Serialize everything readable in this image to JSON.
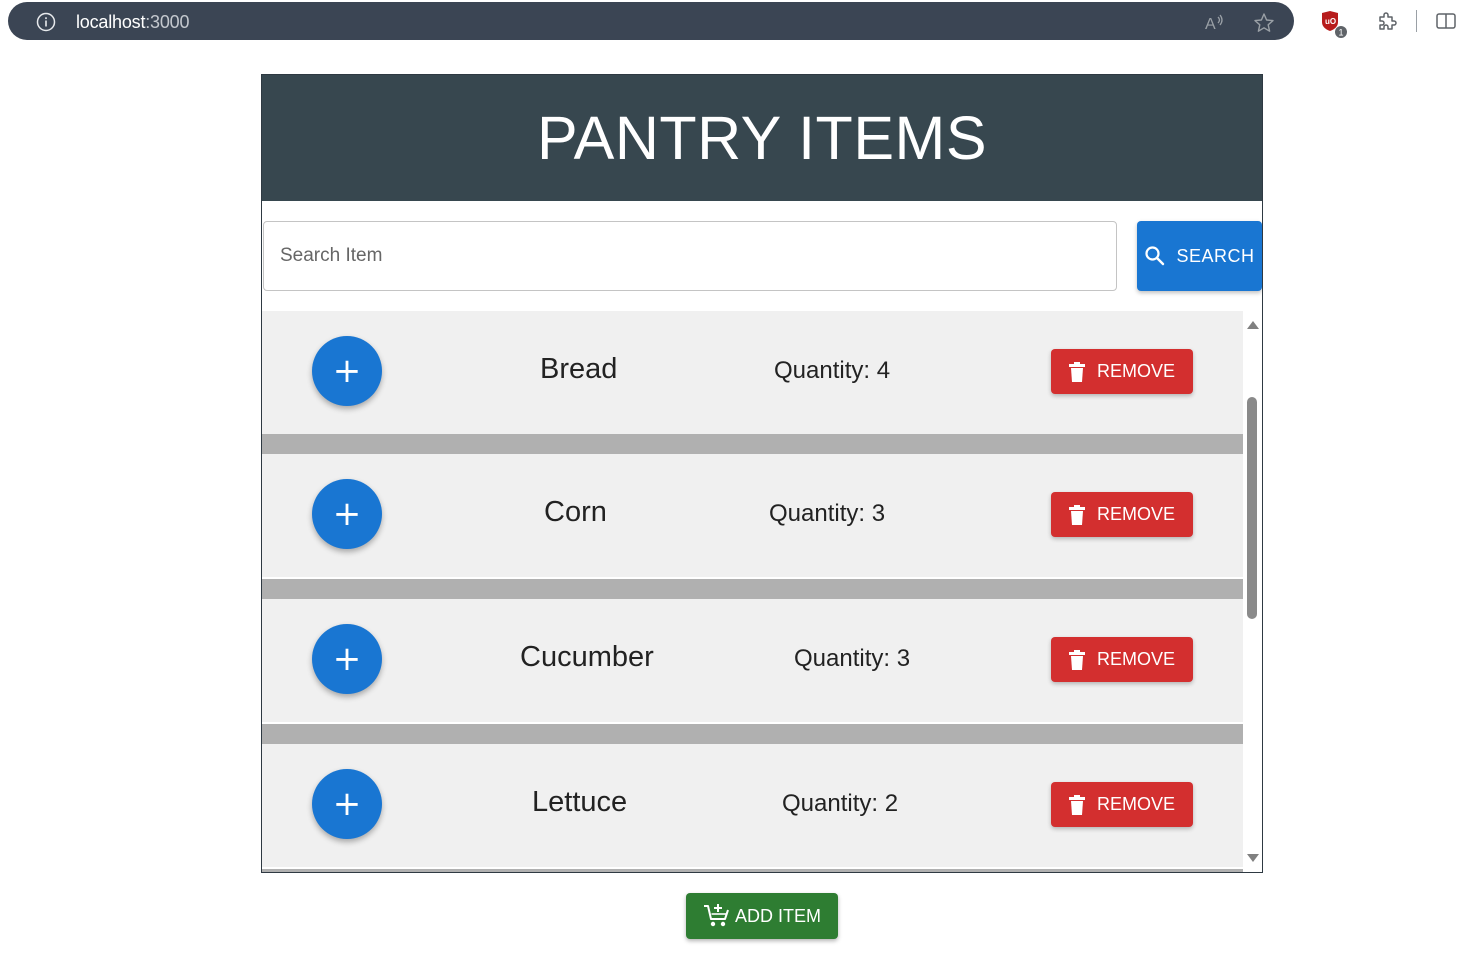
{
  "browser": {
    "url_host": "localhost",
    "url_port": ":3000",
    "ublock_badge": "1"
  },
  "header": {
    "title": "PANTRY ITEMS"
  },
  "search": {
    "placeholder": "Search Item",
    "value": "",
    "button_label": "SEARCH"
  },
  "items": [
    {
      "name": "Bread",
      "quantity": "Quantity: 4",
      "remove_label": "REMOVE",
      "add_label": "+"
    },
    {
      "name": "Corn",
      "quantity": "Quantity: 3",
      "remove_label": "REMOVE",
      "add_label": "+"
    },
    {
      "name": "Cucumber",
      "quantity": "Quantity: 3",
      "remove_label": "REMOVE",
      "add_label": "+"
    },
    {
      "name": "Lettuce",
      "quantity": "Quantity: 2",
      "remove_label": "REMOVE",
      "add_label": "+"
    }
  ],
  "footer": {
    "add_item_label": "ADD ITEM"
  },
  "icons": {
    "info": "info-icon",
    "read_aloud": "read-aloud-icon",
    "favorite": "star-icon",
    "ublock": "ublock-icon",
    "extensions": "puzzle-icon",
    "split_screen": "split-screen-icon",
    "search": "search-icon",
    "trash": "trash-icon",
    "add_cart": "add-shopping-cart-icon"
  },
  "colors": {
    "header_bg": "#37474f",
    "primary": "#1976d2",
    "danger": "#d32f2f",
    "success": "#2e7d32",
    "row_bg": "#f0f0f0",
    "row_separator": "#b0b0b0"
  }
}
